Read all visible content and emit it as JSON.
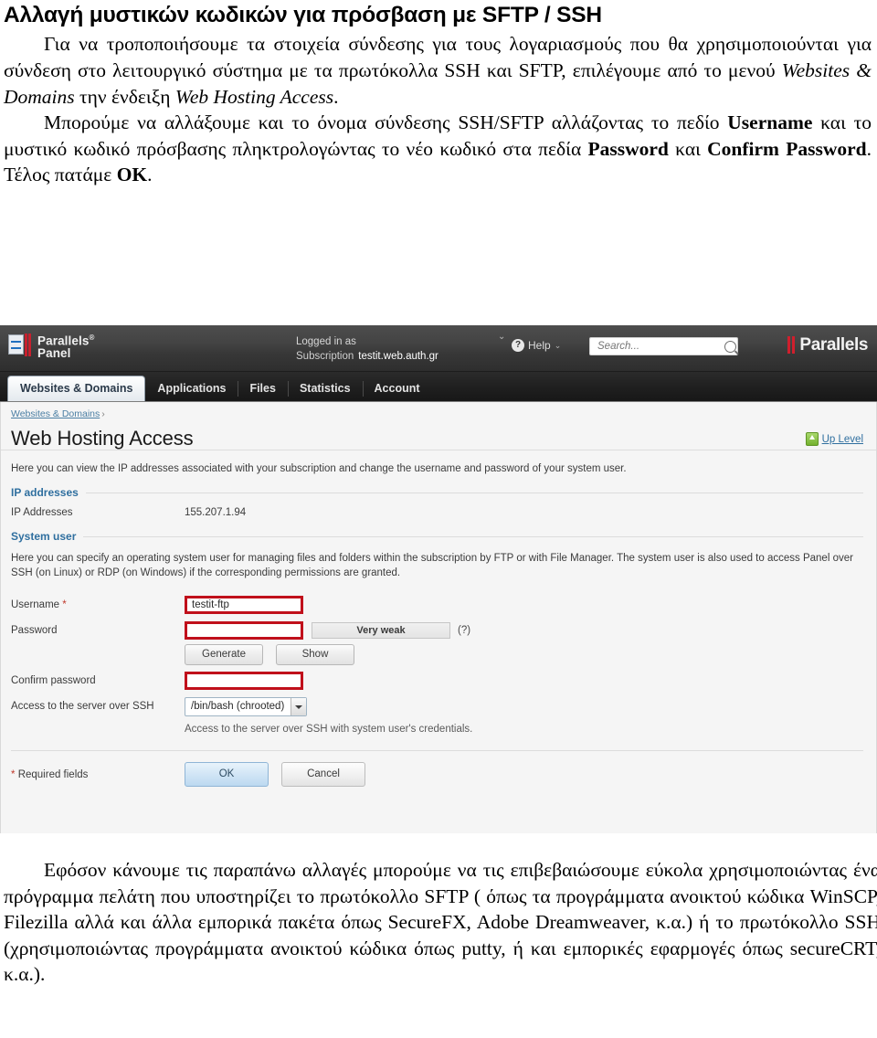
{
  "document": {
    "title": "Αλλαγή μυστικών κωδικών για πρόσβαση με SFTP / SSH",
    "paragraph1_part1": "Για να τροποποιήσουμε τα στοιχεία σύνδεσης για τους λογαριασμούς που θα χρησιμοποιούνται για σύνδεση στο λειτουργικό σύστημα με τα πρωτόκολλα SSH και SFTP, επιλέγουμε από το μενού ",
    "paragraph1_italic1": "Websites & Domains",
    "paragraph1_part2": " την ένδειξη ",
    "paragraph1_italic2": "Web Hosting Access",
    "paragraph1_part3": ".",
    "paragraph2_part1": "Μπορούμε να αλλάξουμε και το όνομα σύνδεσης SSH/SFTP αλλάζοντας το πεδίο ",
    "paragraph2_bold1": "Username",
    "paragraph2_part2": " και το μυστικό κωδικό πρόσβασης πληκτρολογώντας το νέο κωδικό στα πεδία ",
    "paragraph2_bold2": "Password",
    "paragraph2_part3": " και ",
    "paragraph2_bold3": "Confirm Password",
    "paragraph2_part4": ". Τέλος πατάμε ",
    "paragraph2_bold4": "OK",
    "paragraph2_part5": ".",
    "paragraph3": "Εφόσον κάνουμε τις παραπάνω αλλαγές μπορούμε να τις επιβεβαιώσουμε εύκολα χρησιμοποιώντας ένα πρόγραμμα πελάτη που υποστηρίζει το πρωτόκολλο SFTP ( όπως τα προγράμματα ανοικτού κώδικα WinSCP, Filezilla αλλά και άλλα εμπορικά πακέτα όπως SecureFX, Adobe Dreamweaver, κ.α.) ή το πρωτόκολλο SSH (χρησιμοποιώντας προγράμματα ανοικτού κώδικα όπως putty, ή και εμπορικές εφαρμογές όπως secureCRT, κ.α.)."
  },
  "panel": {
    "brand": {
      "name_line1": "Parallels",
      "name_line2": "Panel",
      "registered": "®",
      "right_logo": "Parallels",
      "right_logo_mark": "'"
    },
    "header": {
      "logged_in_label": "Logged in as",
      "subscription_label": "Subscription",
      "subscription_value": "testit.web.auth.gr",
      "help_label": "Help",
      "help_glyph": "?",
      "caret_glyph": "⌄"
    },
    "search": {
      "placeholder": "Search...",
      "value": ""
    },
    "tabs": [
      {
        "label": "Websites & Domains",
        "active": true
      },
      {
        "label": "Applications",
        "active": false
      },
      {
        "label": "Files",
        "active": false
      },
      {
        "label": "Statistics",
        "active": false
      },
      {
        "label": "Account",
        "active": false
      }
    ],
    "breadcrumb": {
      "root": "Websites & Domains",
      "separator": "›"
    },
    "page_title": "Web Hosting Access",
    "up_level_label": "Up Level",
    "intro_text": "Here you can view the IP addresses associated with your subscription and change the username and password of your system user.",
    "sections": {
      "ip": {
        "heading": "IP addresses",
        "row_label": "IP Addresses",
        "row_value": "155.207.1.94"
      },
      "system_user": {
        "heading": "System user",
        "help_line1": "Here you can specify an operating system user for managing files and folders within the subscription by FTP or with File Manager. The system user is also used to",
        "help_line2": "access Panel over SSH (on Linux) or RDP (on Windows) if the corresponding permissions are granted."
      }
    },
    "form": {
      "username_label": "Username",
      "username_required_mark": "*",
      "username_value": "testit-ftp",
      "password_label": "Password",
      "password_value": "",
      "password_strength": "Very weak",
      "password_help_glyph": "(?)",
      "generate_label": "Generate",
      "show_label": "Show",
      "confirm_label": "Confirm password",
      "confirm_value": "",
      "ssh_label": "Access to the server over SSH",
      "ssh_value": "/bin/bash (chrooted)",
      "ssh_hint": "Access to the server over SSH with system user's credentials.",
      "required_fields_note": "Required fields",
      "required_star": "*",
      "ok_label": "OK",
      "cancel_label": "Cancel"
    },
    "colors": {
      "header_dark": "#3a3a3a",
      "link_blue": "#2f6f9f",
      "section_blue": "#2f6f9f",
      "highlight_red": "#c0101b",
      "accent_red": "#cf1f2d",
      "body_bg": "#f5f5f5"
    }
  }
}
